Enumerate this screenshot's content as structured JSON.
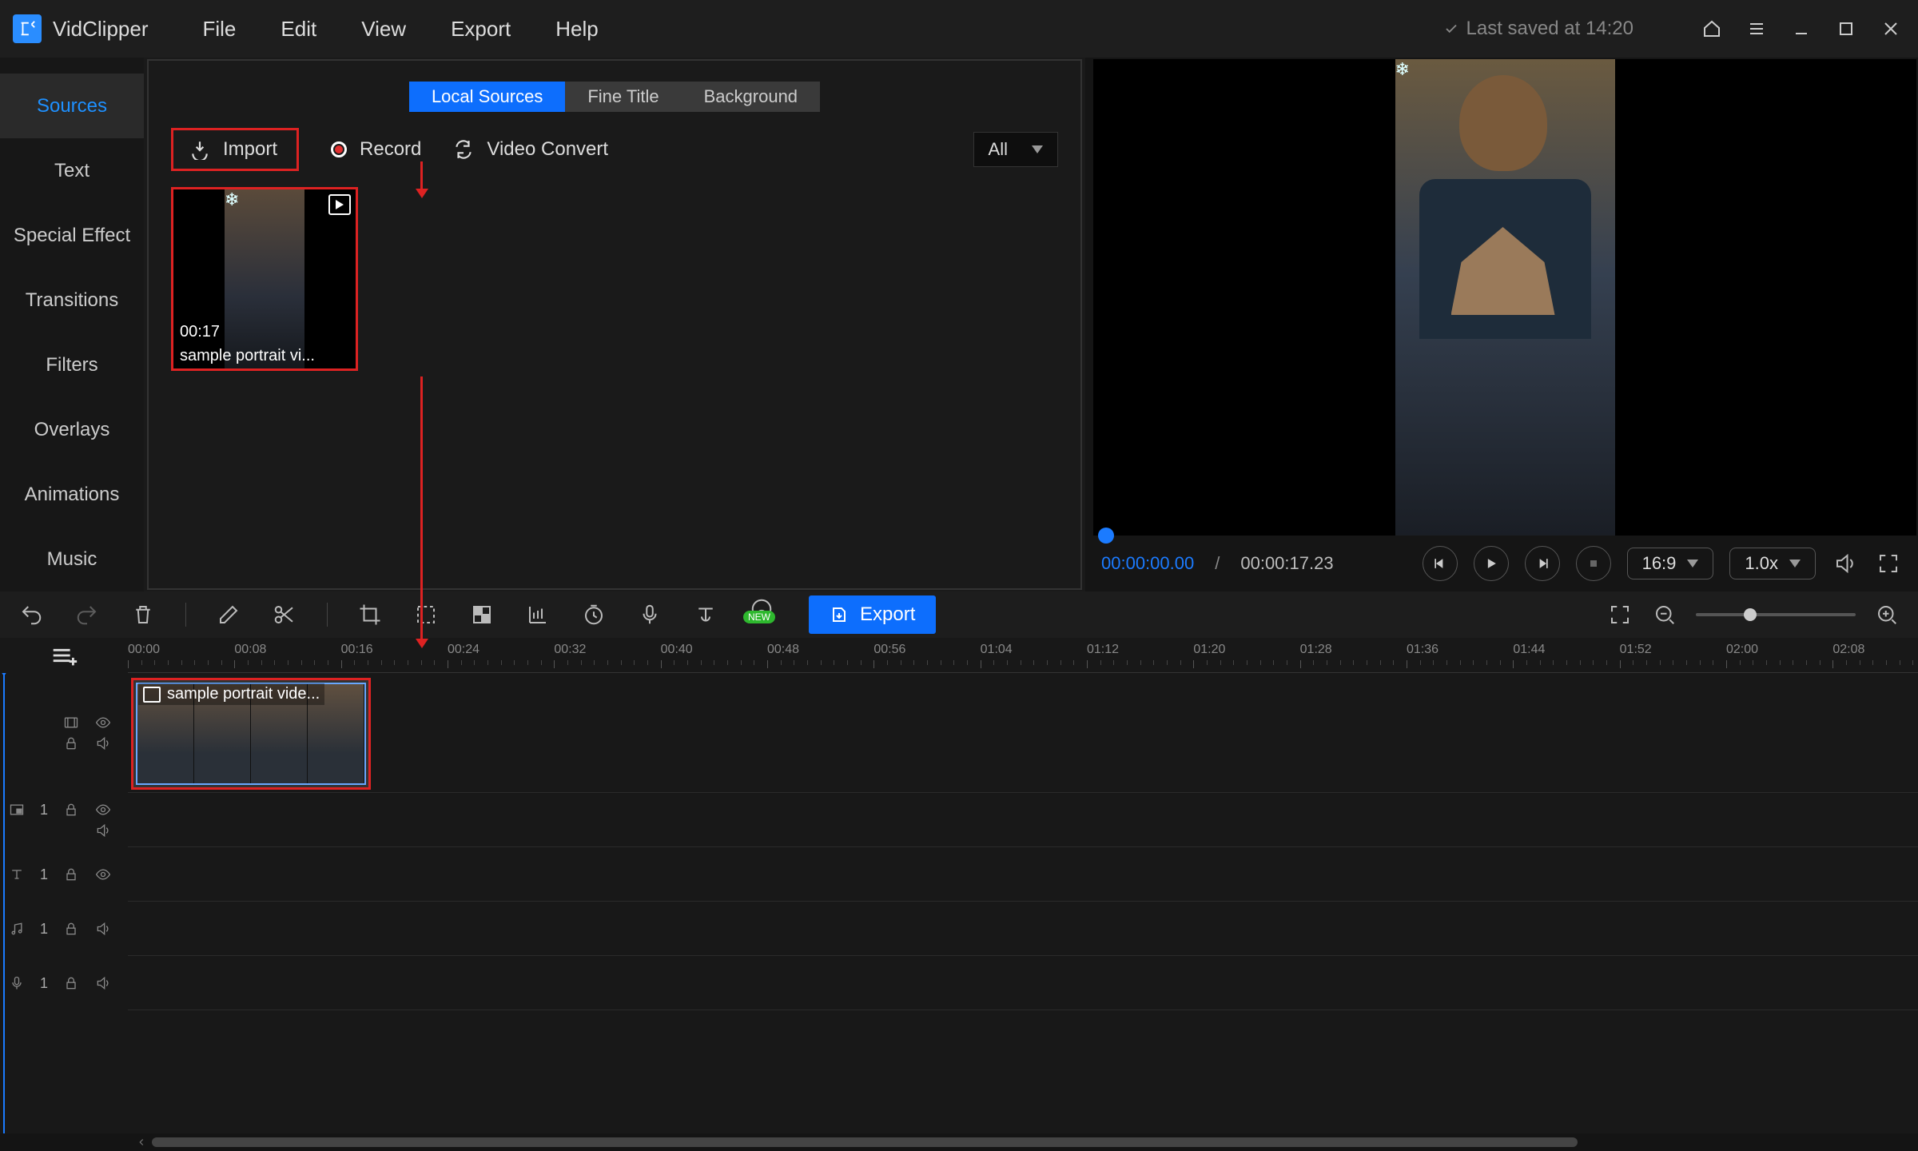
{
  "app": {
    "name": "VidClipper",
    "save_status": "Last saved at 14:20"
  },
  "menu": {
    "file": "File",
    "edit": "Edit",
    "view": "View",
    "export": "Export",
    "help": "Help"
  },
  "sidebar": {
    "items": [
      {
        "label": "Sources",
        "active": true
      },
      {
        "label": "Text"
      },
      {
        "label": "Special Effect"
      },
      {
        "label": "Transitions"
      },
      {
        "label": "Filters"
      },
      {
        "label": "Overlays"
      },
      {
        "label": "Animations"
      },
      {
        "label": "Music"
      }
    ]
  },
  "source_panel": {
    "tabs": {
      "local": "Local Sources",
      "fine": "Fine Title",
      "bg": "Background"
    },
    "import": "Import",
    "record": "Record",
    "convert": "Video Convert",
    "filter": "All",
    "clip": {
      "duration": "00:17",
      "name": "sample portrait vi..."
    }
  },
  "preview": {
    "current": "00:00:00.00",
    "sep": "/",
    "duration": "00:00:17.23",
    "ratio": "16:9",
    "speed": "1.0x"
  },
  "toolbar": {
    "export": "Export",
    "new_badge": "NEW"
  },
  "timeline": {
    "ticks": [
      "00:00",
      "00:08",
      "00:16",
      "00:24",
      "00:32",
      "00:40",
      "00:48",
      "00:56",
      "01:04",
      "01:12",
      "01:20",
      "01:28",
      "01:36",
      "01:44",
      "01:52",
      "02:00",
      "02:08"
    ],
    "clip_label": "sample portrait vide...",
    "track_num": "1"
  }
}
